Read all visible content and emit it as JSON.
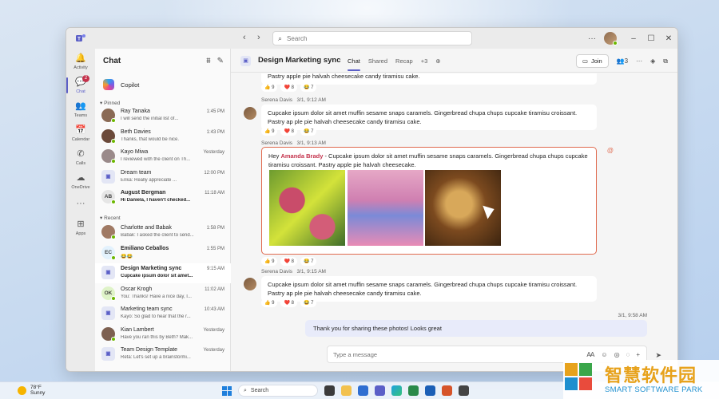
{
  "titlebar": {
    "search_placeholder": "Search",
    "more": "···"
  },
  "rail": {
    "items": [
      {
        "label": "Activity",
        "icon": "bell-icon"
      },
      {
        "label": "Chat",
        "icon": "chat-icon",
        "badge": "2"
      },
      {
        "label": "Teams",
        "icon": "teams-icon"
      },
      {
        "label": "Calendar",
        "icon": "calendar-icon"
      },
      {
        "label": "Calls",
        "icon": "phone-icon"
      },
      {
        "label": "OneDrive",
        "icon": "cloud-icon"
      },
      {
        "label": "···",
        "icon": "more-icon"
      },
      {
        "label": "Apps",
        "icon": "apps-icon"
      }
    ]
  },
  "chatlist": {
    "title": "Chat",
    "copilot": "Copilot",
    "pinned_label": "Pinned",
    "recent_label": "Recent",
    "pinned": [
      {
        "name": "Ray Tanaka",
        "preview": "I will send the initial list of...",
        "time": "1:45 PM",
        "initials": "RT",
        "color": "#8a6a55"
      },
      {
        "name": "Beth Davies",
        "preview": "Thanks, that would be nice.",
        "time": "1:43 PM",
        "initials": "BD",
        "color": "#6b4a3a"
      },
      {
        "name": "Kayo Miwa",
        "preview": "I reviewed with the client on Th...",
        "time": "Yesterday",
        "initials": "KM",
        "color": "#9a8a8a"
      },
      {
        "name": "Dream team",
        "preview": "Erika: Really appreciate ...",
        "time": "12:00 PM",
        "initials": "DT",
        "color": "#e8f0ff"
      },
      {
        "name": "August Bergman",
        "preview": "Hi Daniela, I haven't checked...",
        "time": "11:18 AM",
        "initials": "AB",
        "color": "#e6e6e6"
      }
    ],
    "recent": [
      {
        "name": "Charlotte and Babak",
        "preview": "Babak: I asked the client to send...",
        "time": "1:58 PM",
        "initials": "CB",
        "color": "#a07a64"
      },
      {
        "name": "Emiliano Ceballos",
        "preview": "😂😂",
        "time": "1:55 PM",
        "initials": "EC",
        "color": "#e3f2fd"
      },
      {
        "name": "Design Marketing sync",
        "preview": "Cupcake ipsum dolor sit amet...",
        "time": "9:15 AM",
        "initials": "DM",
        "color": "#e3e6f5"
      },
      {
        "name": "Oscar Krogh",
        "preview": "You: Thanks! Have a nice day, I...",
        "time": "11:02 AM",
        "initials": "OK",
        "color": "#dff3c8"
      },
      {
        "name": "Marketing team sync",
        "preview": "Kayo: So glad to hear that the r...",
        "time": "10:43 AM",
        "initials": "MT",
        "color": "#e3e6f5"
      },
      {
        "name": "Kian Lambert",
        "preview": "Have you ran this by Beth? Mak...",
        "time": "Yesterday",
        "initials": "KL",
        "color": "#7d6050"
      },
      {
        "name": "Team Design Template",
        "preview": "Reta: Let's set up a brainstormi...",
        "time": "Yesterday",
        "initials": "TD",
        "color": "#e3e6f5"
      }
    ]
  },
  "conversation": {
    "title": "Design Marketing sync",
    "tabs": [
      "Chat",
      "Shared",
      "Recap",
      "+3"
    ],
    "join_label": "Join",
    "participants": "3",
    "first_bubble_tail": "Pastry apple pie halvah cheesecake candy tiramisu cake.",
    "messages": [
      {
        "sender": "Serena Davis",
        "time": "3/1, 9:12 AM",
        "text": "Cupcake ipsum dolor sit amet muffin sesame snaps caramels. Gingerbread chupa chups cupcake tiramisu croissant. Pastry ap ple pie halvah cheesecake candy tiramisu cake.",
        "reactions": [
          "👍 9",
          "❤️ 8",
          "😂 7"
        ]
      },
      {
        "sender": "Serena Davis",
        "time": "3/1, 9:13 AM",
        "greeting": "Hey",
        "mention": "Amanda Brady",
        "text": " - Cupcake ipsum dolor sit amet muffin sesame snaps caramels. Gingerbread chupa chups cupcake tiramisu croissant. Pastry apple pie halvah cheesecake.",
        "reactions": [
          "👍 9",
          "❤️ 8",
          "😂 7"
        ]
      },
      {
        "sender": "Serena Davis",
        "time": "3/1, 9:15 AM",
        "text": "Cupcake ipsum dolor sit amet muffin sesame snaps caramels. Gingerbread chupa chups cupcake tiramisu croissant. Pastry ap ple pie halvah cheesecake candy tiramisu cake.",
        "reactions": [
          "👍 9",
          "❤️ 8",
          "😂 7"
        ]
      }
    ],
    "first_reactions": [
      "👍 9",
      "❤️ 8",
      "😂 7"
    ],
    "my_message": {
      "time": "3/1, 9:58 AM",
      "text": "Thank you for sharing these photos! Looks great"
    },
    "compose_placeholder": "Type a message"
  },
  "taskbar": {
    "temp": "78°F",
    "condition": "Sunny",
    "search": "Search"
  },
  "watermark": {
    "cn": "智慧软件园",
    "en": "SMART SOFTWARE PARK"
  }
}
